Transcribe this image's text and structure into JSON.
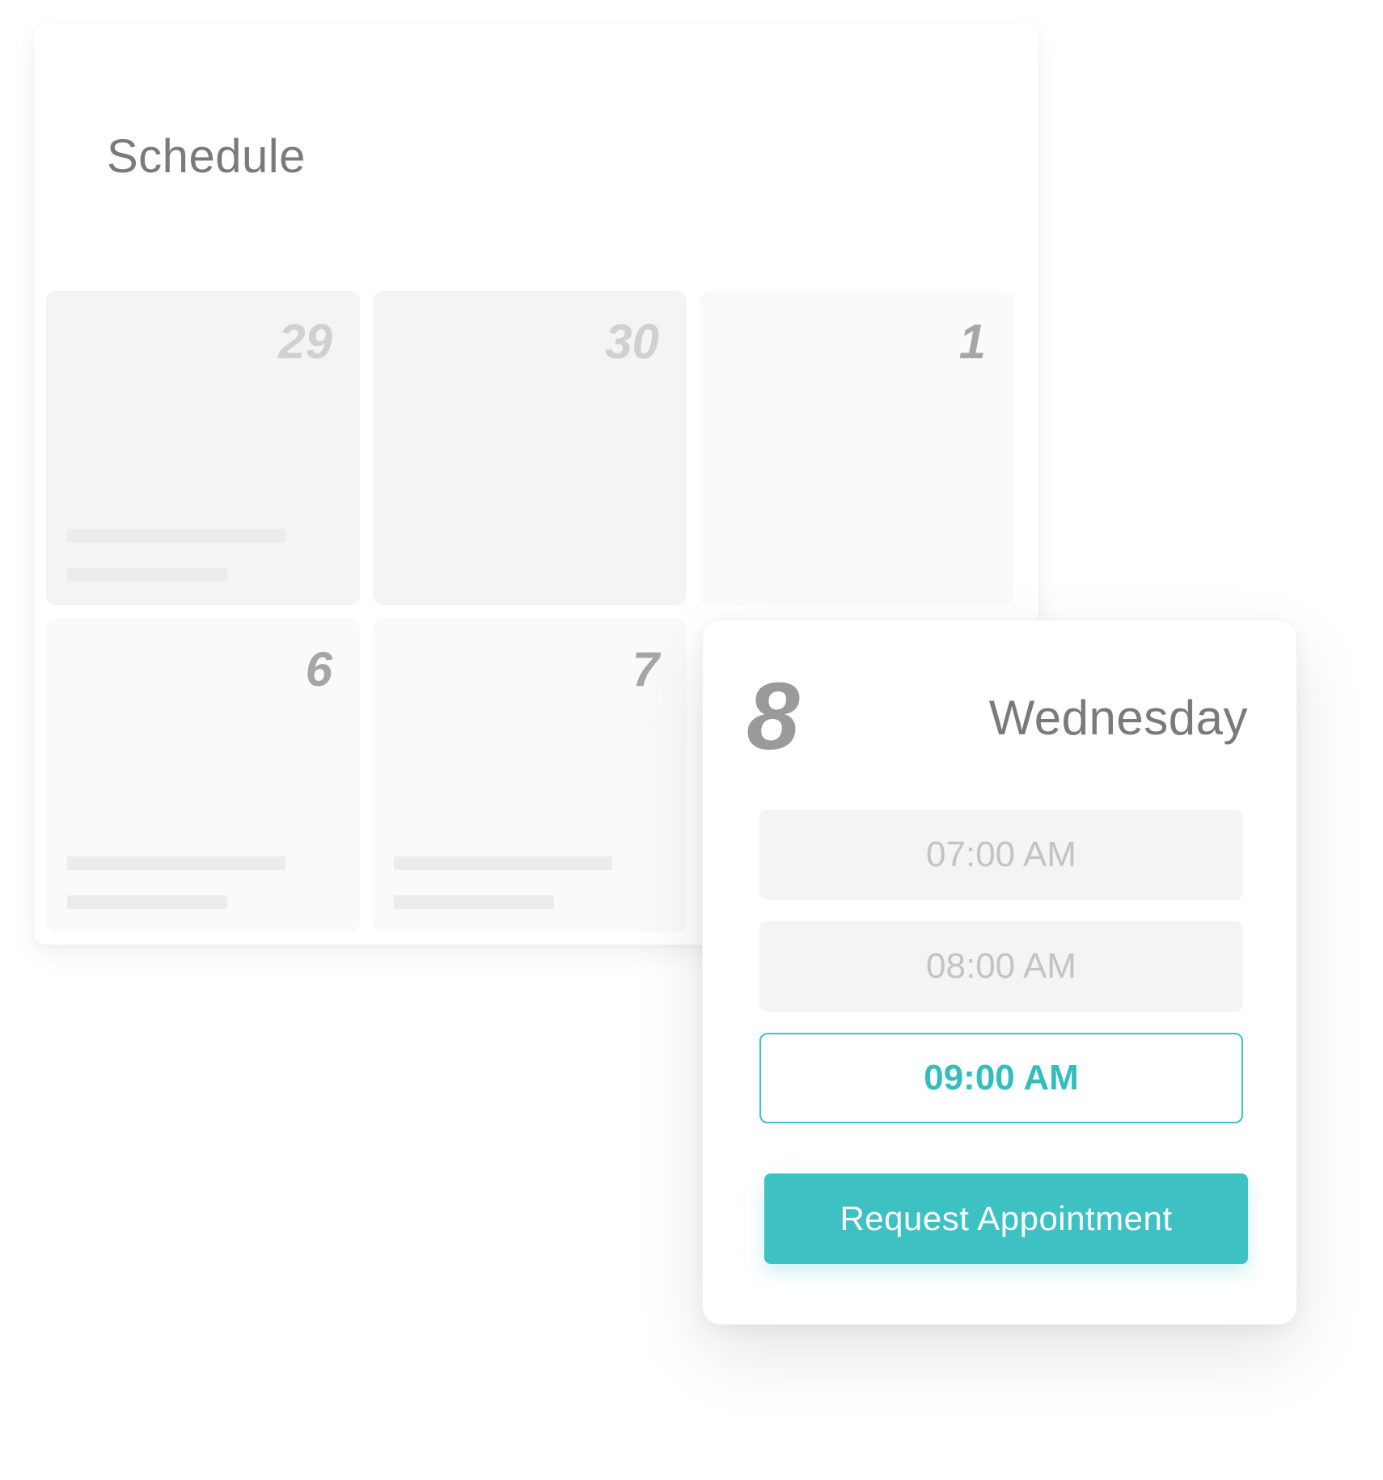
{
  "schedule": {
    "title": "Schedule",
    "days": [
      {
        "number": "29",
        "color": "#d0d0d0"
      },
      {
        "number": "30",
        "color": "#d0d0d0"
      },
      {
        "number": "1",
        "color": "#a6a6a6"
      },
      {
        "number": "6",
        "color": "#a6a6a6"
      },
      {
        "number": "7",
        "color": "#a6a6a6"
      }
    ]
  },
  "popup": {
    "day_number": "8",
    "weekday": "Wednesday",
    "time_slots": [
      {
        "label": "07:00 AM",
        "state": "available"
      },
      {
        "label": "08:00 AM",
        "state": "available"
      },
      {
        "label": "09:00 AM",
        "state": "selected"
      }
    ],
    "request_button_label": "Request Appointment"
  },
  "colors": {
    "accent": "#3ec1c3",
    "text_muted": "#7a7a7a",
    "cell_bg": "#f5f5f5"
  }
}
